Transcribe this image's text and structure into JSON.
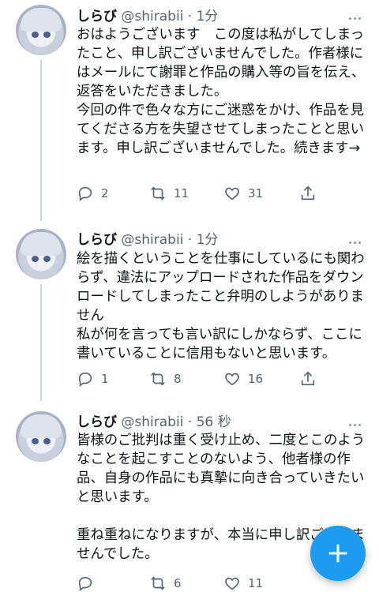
{
  "tweets": [
    {
      "name": "しらび",
      "meta": " @shirabii · 1分",
      "text": "おはようございます　この度は私がしてしまったこと、申し訳ございませんでした。作者様にはメールにて謝罪と作品の購入等の旨を伝え、返答をいただきました。\n今回の件で色々な方にご迷惑をかけ、作品を見てくださる方を失望させてしまったことと思います。申し訳ございませんでした。続きます→",
      "replies": "2",
      "retweets": "11",
      "likes": "31"
    },
    {
      "name": "しらび",
      "meta": " @shirabii · 1分",
      "text": "絵を描くということを仕事にしているにも関わらず、違法にアップロードされた作品をダウンロードしてしまったこと弁明のしようがありません\n私が何を言っても言い訳にしかならず、ここに書いていることに信用もないと思います。",
      "replies": "1",
      "retweets": "8",
      "likes": "16"
    },
    {
      "name": "しらび",
      "meta": " @shirabii · 56 秒",
      "text": "皆様のご批判は重く受け止め、二度とこのようなことを起こすことのないよう、他者様の作品、自身の作品にも真摯に向き合っていきたいと思います。\n\n重ね重ねになりますが、本当に申し訳ございませんでした。",
      "replies": "",
      "retweets": "6",
      "likes": "11"
    }
  ],
  "compose_button": {
    "icon": "plus-icon",
    "color": "#1d9bf0"
  },
  "colors": {
    "accent": "#1d9bf0",
    "muted": "#536471",
    "text": "#0f1419"
  }
}
